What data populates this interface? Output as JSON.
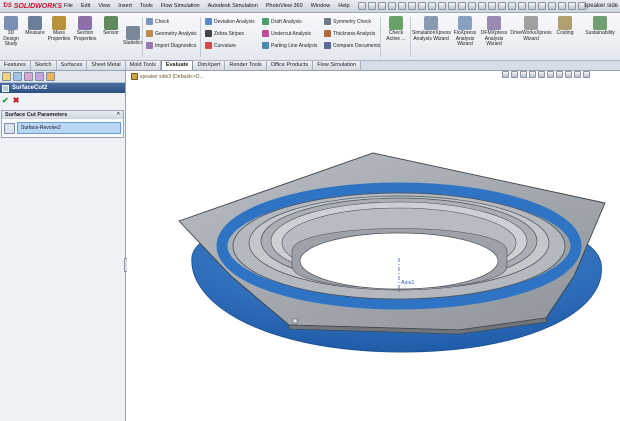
{
  "titlebar": {
    "logo": "SOLIDWORKS",
    "menus": [
      "File",
      "Edit",
      "View",
      "Insert",
      "Tools",
      "Flow Simulation",
      "Autodesk Simulation",
      "PhotoView 360",
      "Window",
      "Help"
    ],
    "doc_title": "speaker side"
  },
  "toolbar": {
    "big_tools": [
      {
        "label": "3D\nDesign\nStudy",
        "color": "#7b8fb5"
      },
      {
        "label": "Measure",
        "color": "#6b7f99"
      },
      {
        "label": "Mass\nProperties",
        "color": "#b8923a"
      },
      {
        "label": "Section\nProperties",
        "color": "#8c6fa8"
      },
      {
        "label": "Sensor",
        "color": "#5f8a5f"
      },
      {
        "label": "Statistics",
        "color": "#7a8898"
      }
    ],
    "small_tools": [
      {
        "label": "Check",
        "color": "#7a96c0"
      },
      {
        "label": "Geometry Analysis",
        "color": "#c08a4a"
      },
      {
        "label": "Import Diagnostics",
        "color": "#9a7ab5"
      },
      {
        "label": "Deviation Analysis",
        "color": "#5a8acb"
      },
      {
        "label": "Zebra Stripes",
        "color": "#444444"
      },
      {
        "label": "Curvature",
        "color": "#d04a4a"
      },
      {
        "label": "Draft Analysis",
        "color": "#4aa06a"
      },
      {
        "label": "Undercut Analysis",
        "color": "#c04a9a"
      },
      {
        "label": "Parting Line Analysis",
        "color": "#4a8ab0"
      },
      {
        "label": "Symmetry Check",
        "color": "#6a7a8a"
      },
      {
        "label": "Thickness Analysis",
        "color": "#b06a3a"
      },
      {
        "label": "Compare Documents",
        "color": "#5a6a9a"
      }
    ],
    "right_tools": [
      {
        "label": "Check\nActive ...",
        "color": "#6aa06a"
      },
      {
        "label": "SimulationXpress\nAnalysis Wizard",
        "color": "#8a9ab0"
      },
      {
        "label": "FloXpress\nAnalysis\nWizard",
        "color": "#8aa0c0"
      },
      {
        "label": "DFMXpress\nAnalysis\nWizard",
        "color": "#9a8ab0"
      },
      {
        "label": "DriveWorksXpress\nWizard",
        "color": "#a0a0a0"
      },
      {
        "label": "Costing",
        "color": "#b0a070"
      },
      {
        "label": "Sustainability",
        "color": "#70a070"
      }
    ]
  },
  "tabs": [
    "Features",
    "Sketch",
    "Surfaces",
    "Sheet Metal",
    "Mold Tools",
    "Evaluate",
    "DimXpert",
    "Render Tools",
    "Office Products",
    "Flow Simulation"
  ],
  "active_tab": "Evaluate",
  "panel": {
    "feature_name": "SurfaceCut2",
    "group_title": "Surface Cut Parameters",
    "surface_value": "Surface-Revolve2",
    "ok_glyph": "✔",
    "cancel_glyph": "✖",
    "collapse_glyph": "^"
  },
  "viewport": {
    "tree_flyout": "speaker side3 (Default<<D...",
    "axis_label": "Axis1",
    "model_color": "#2f74c4",
    "plate_color": "#c9cdd1"
  }
}
